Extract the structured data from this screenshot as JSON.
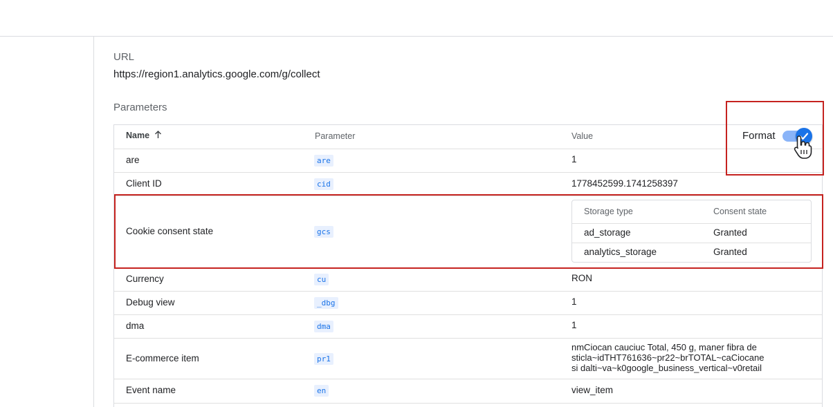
{
  "request": {
    "url_label": "URL",
    "url_value": "https://region1.analytics.google.com/g/collect",
    "parameters_label": "Parameters"
  },
  "table": {
    "headers": {
      "name": "Name",
      "name_sort_icon": "arrow-up-icon",
      "parameter": "Parameter",
      "value": "Value"
    },
    "format_toggle": {
      "label": "Format",
      "checked": true
    },
    "rows": [
      {
        "name": "are",
        "parameter": "are",
        "value": "1"
      },
      {
        "name": "Client ID",
        "parameter": "cid",
        "value": "1778452599.1741258397"
      },
      {
        "name": "Cookie consent state",
        "parameter": "gcs",
        "value": ""
      },
      {
        "name": "Currency",
        "parameter": "cu",
        "value": "RON"
      },
      {
        "name": "Debug view",
        "parameter": "_dbg",
        "value": "1"
      },
      {
        "name": "dma",
        "parameter": "dma",
        "value": "1"
      },
      {
        "name": "E-commerce item",
        "parameter": "pr1",
        "value_lines": [
          "nmCiocan cauciuc Total, 450 g, maner fibra de",
          "sticla~idTHT761636~pr22~brTOTAL~caCiocane",
          "si dalti~va~k0google_business_vertical~v0retail"
        ]
      },
      {
        "name": "Event name",
        "parameter": "en",
        "value": "view_item"
      }
    ],
    "consent": {
      "headers": {
        "storage_type": "Storage type",
        "consent_state": "Consent state"
      },
      "rows": [
        {
          "storage_type": "ad_storage",
          "consent_state": "Granted"
        },
        {
          "storage_type": "analytics_storage",
          "consent_state": "Granted"
        }
      ]
    }
  },
  "colors": {
    "highlight": "#c5221f",
    "accent": "#1a73e8",
    "chip_background": "#e8f0fe"
  },
  "icons": {
    "toggle_check": "check-icon",
    "cursor": "hand-pointer-icon"
  }
}
